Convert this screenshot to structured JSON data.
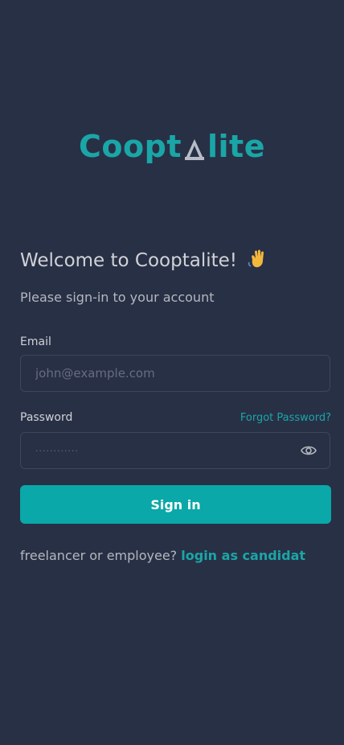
{
  "brand": {
    "name_left": "Coopt",
    "name_right": "lite",
    "color": "#1aa6a6"
  },
  "welcome": {
    "title": "Welcome to Cooptalite!",
    "emoji_icon": "waving-hand-icon",
    "subtitle": "Please sign-in to your account"
  },
  "form": {
    "email_label": "Email",
    "email_placeholder": "john@example.com",
    "password_label": "Password",
    "forgot_password": "Forgot Password?",
    "password_value": "············",
    "toggle_icon": "eye-icon",
    "submit_label": "Sign in"
  },
  "footer": {
    "prompt": "freelancer or employee?",
    "link": "login as candidat"
  },
  "colors": {
    "background": "#283046",
    "accent": "#0aa8a8",
    "input_border": "#404656"
  }
}
